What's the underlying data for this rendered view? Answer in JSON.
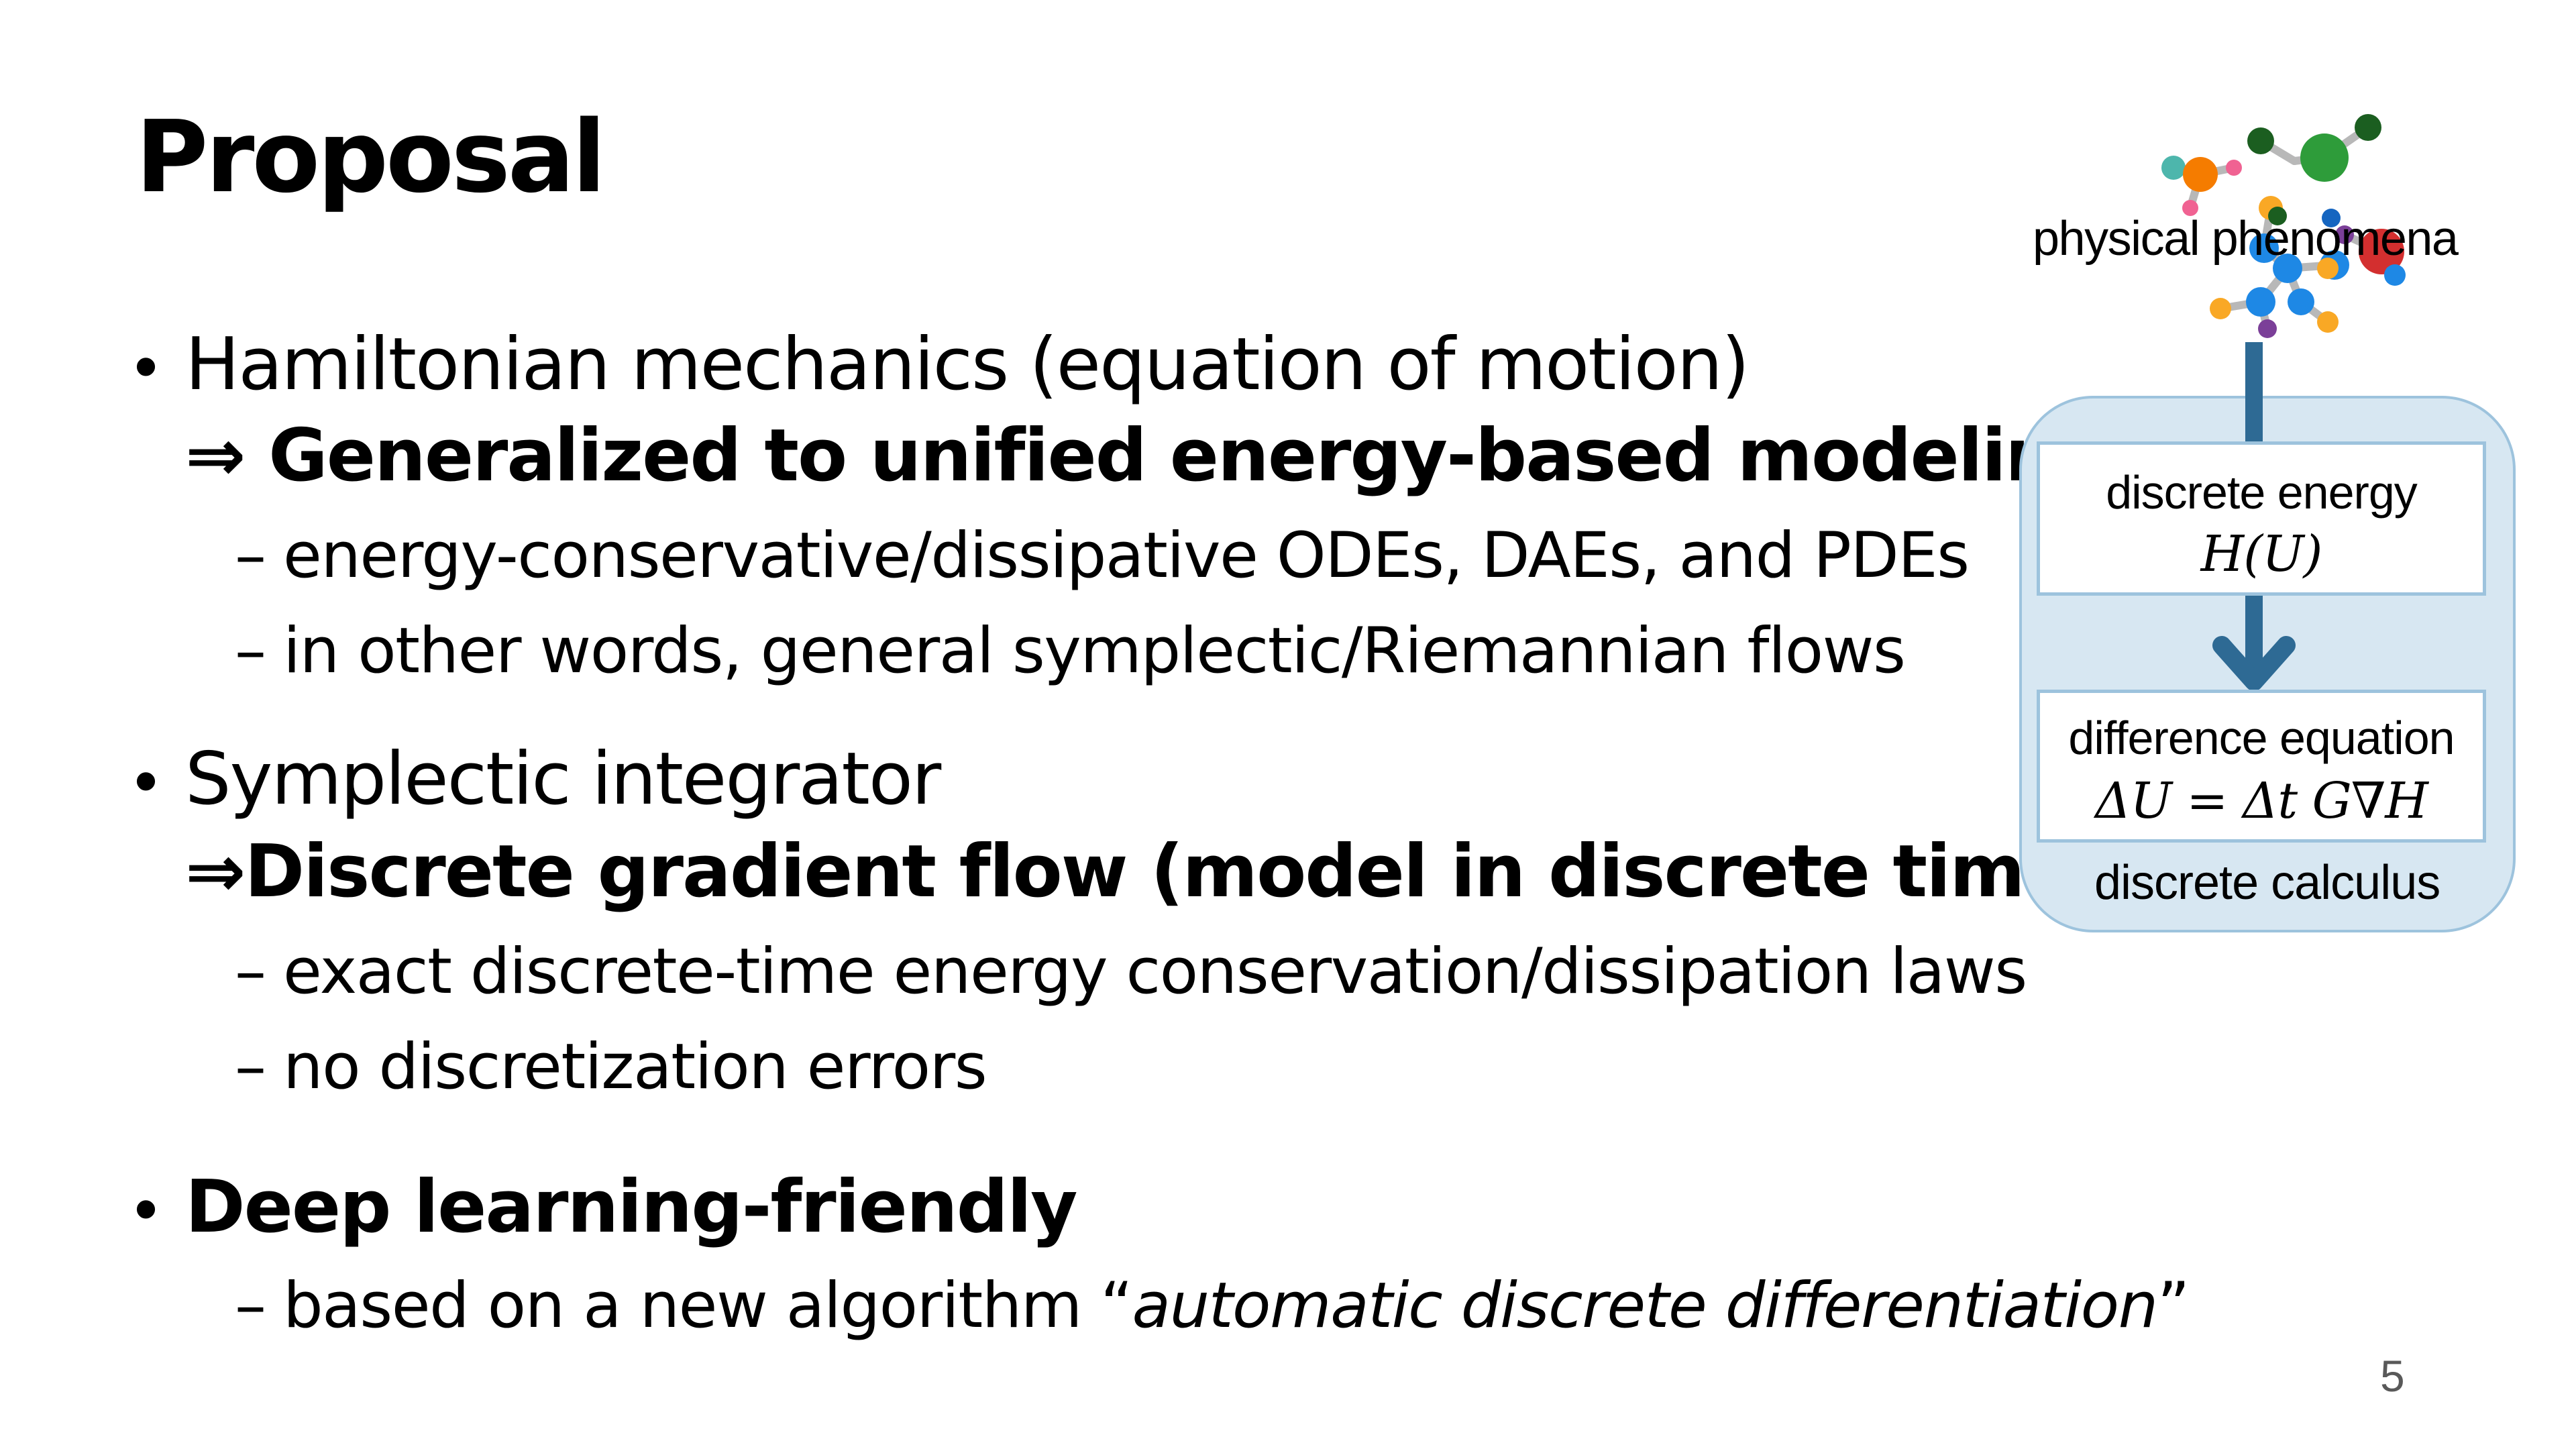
{
  "slide": {
    "title": "Proposal",
    "bullets": [
      {
        "symbol": "•",
        "text": "Hamiltonian mechanics (equation of motion)",
        "implication_arrow": "⇒",
        "implication": "Generalized to unified energy-based modeling",
        "subitems": [
          "energy-conservative/dissipative ODEs, DAEs, and PDEs",
          "in other words, general symplectic/Riemannian flows"
        ]
      },
      {
        "symbol": "•",
        "text": "Symplectic integrator",
        "implication_arrow": "⇒",
        "implication": "Discrete gradient flow (model in discrete time)",
        "subitems": [
          "exact discrete-time energy conservation/dissipation laws",
          "no discretization errors"
        ]
      },
      {
        "symbol": "•",
        "text": "Deep learning-friendly",
        "subitem_prefix": "based on a new algorithm “",
        "subitem_italic": "automatic discrete differentiation",
        "subitem_suffix": "”"
      }
    ],
    "dash": "–",
    "page_number": "5"
  },
  "diagram": {
    "top_label": "physical phenomena",
    "box1_line1": "discrete energy",
    "box1_line2": "H(U)",
    "box2_line1": "difference equation",
    "box2_line2": "ΔU = Δt G∇H",
    "bottom_label": "discrete calculus",
    "colors": {
      "arrow": "#2e6a94",
      "panel_fill": "#d7e7f2",
      "panel_border": "#9dc3dd"
    },
    "molecule_icon": "molecule-illustration"
  }
}
